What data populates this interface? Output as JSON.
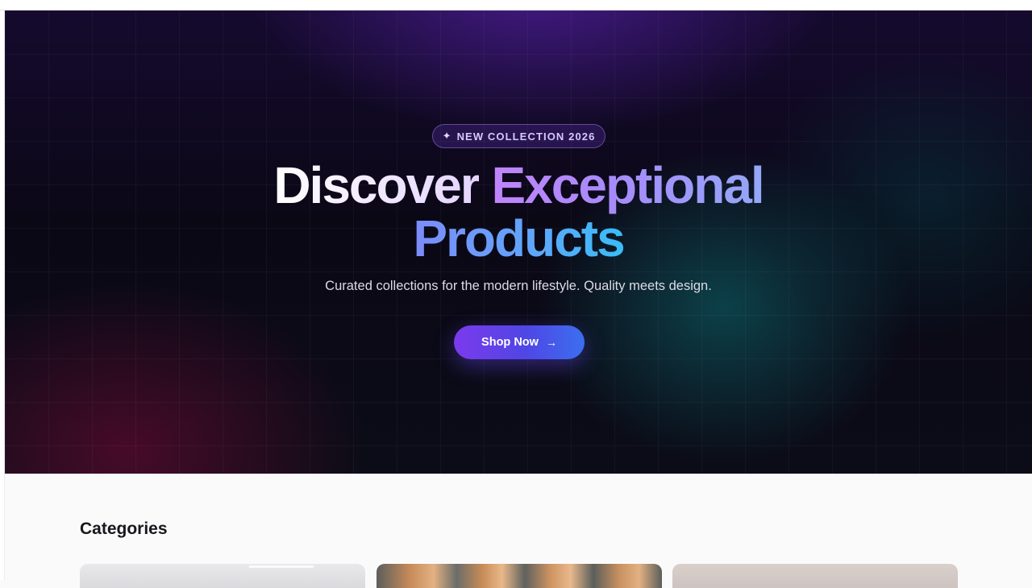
{
  "hero": {
    "badge_icon": "sparkle-icon",
    "badge_glyph": "✦",
    "badge": "NEW COLLECTION 2026",
    "headline_word1": "Discover",
    "headline_word2": "Exceptional",
    "headline_word3": "Products",
    "subtitle": "Curated collections for the modern lifestyle. Quality meets design.",
    "cta_label": "Shop Now",
    "cta_icon": "arrow-right-icon",
    "cta_glyph": "→",
    "colors": {
      "background": "#0b0816",
      "accent_purple": "#7c3aed",
      "accent_blue": "#3b6ff0",
      "gradient_text_start": "#c084fc",
      "gradient_text_end": "#38bdf8"
    }
  },
  "categories": {
    "title": "Categories",
    "cards": [
      {
        "image": "category-image-1"
      },
      {
        "image": "category-image-2"
      },
      {
        "image": "category-image-3"
      }
    ]
  }
}
